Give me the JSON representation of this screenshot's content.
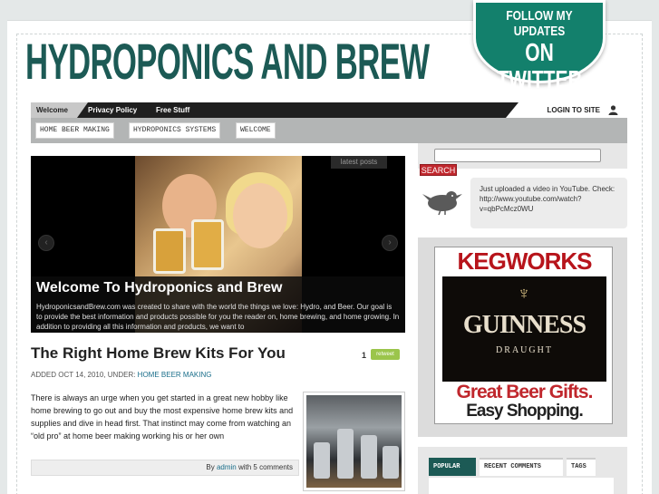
{
  "header": {
    "logo_text": "HYDROPONICS AND BREW",
    "twitter_line1": "FOLLOW MY UPDATES",
    "twitter_line2": "ON TWITTER"
  },
  "nav": {
    "items": [
      "Welcome",
      "Privacy Policy",
      "Free Stuff"
    ],
    "login": "LOGIN TO SITE"
  },
  "categories": [
    "HOME BEER MAKING",
    "HYDROPONICS SYSTEMS",
    "WELCOME"
  ],
  "slider": {
    "tag": "latest posts",
    "title": "Welcome To Hydroponics and Brew",
    "text": "HydroponicsandBrew.com was created to share with the world the things we love: Hydro, and Beer. Our goal is to provide the best information and products possible for you the reader on, home brewing, and home growing. In addition to providing all this information and products, we want to",
    "prev": "‹",
    "next": "›"
  },
  "post": {
    "title": "The Right Home Brew Kits For You",
    "retweet_count": "1",
    "retweet_label": "retweet",
    "meta_prefix": "ADDED OCT 14, 2010, UNDER: ",
    "meta_category": "HOME BEER MAKING",
    "body": "There is always an urge when you get started in a great new hobby like home brewing to go out and buy the most expensive home brew kits and supplies and dive in head first. That instinct may come from watching an “old pro” at home beer making working his or her own",
    "footer_by": "By ",
    "footer_author": "admin",
    "footer_comments": " with 5 comments"
  },
  "sidebar": {
    "search_button": "SEARCH",
    "tweet": "Just uploaded a video in YouTube. Check: http://www.youtube.com/watch?v=qbPcMcz0WU",
    "ad": {
      "brand": "KEGWORKS",
      "product": "GUINNESS",
      "sub": "DRAUGHT",
      "line1": "Great Beer Gifts.",
      "line2": "Easy Shopping."
    },
    "tabs": [
      "POPULAR",
      "RECENT COMMENTS",
      "TAGS"
    ]
  },
  "colors": {
    "brand_green": "#1c5a55",
    "search_red": "#c0272d",
    "retweet_green": "#9bc54b"
  }
}
